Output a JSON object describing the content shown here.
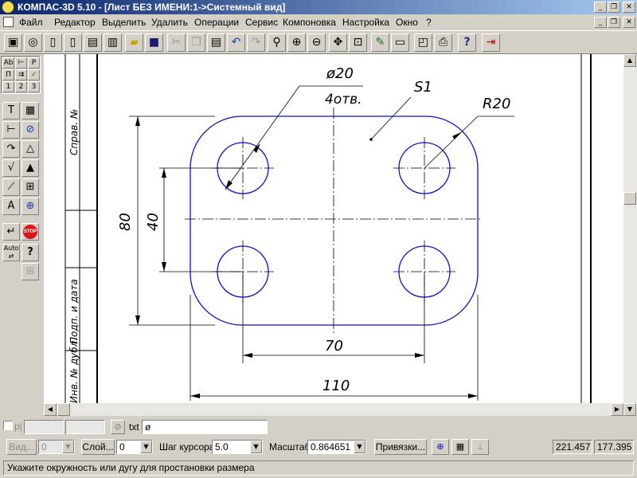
{
  "window": {
    "title": "КОМПАС-3D 5.10 - [Лист БЕЗ ИМЕНИ:1->Системный вид]",
    "minimize_glyph": "_",
    "restore_glyph": "❐",
    "close_glyph": "✕"
  },
  "menu": [
    {
      "label": "Файл"
    },
    {
      "label": "Редактор"
    },
    {
      "label": "Выделить"
    },
    {
      "label": "Удалить"
    },
    {
      "label": "Операции"
    },
    {
      "label": "Сервис"
    },
    {
      "label": "Компоновка"
    },
    {
      "label": "Настройка"
    },
    {
      "label": "Окно"
    },
    {
      "label": "?"
    }
  ],
  "toolbar_icons": [
    "new-sheet-icon",
    "new-fragment-icon",
    "new-document-icon",
    "new-text-icon",
    "new-spec-icon",
    "open-icon",
    "save-icon",
    "cut-icon",
    "copy-icon",
    "paste-icon",
    "undo-icon",
    "redo-icon",
    "zoom-window-icon",
    "zoom-in-icon",
    "zoom-out-icon",
    "pan-icon",
    "zoom-all-icon",
    "refresh-icon",
    "layers-icon",
    "print-preview-icon",
    "print-icon",
    "help-icon",
    "exit-icon"
  ],
  "palette": {
    "mini_labels": [
      "Ab",
      "P",
      "П",
      "1",
      "2",
      "3"
    ]
  },
  "drawing": {
    "dim_d20": "ø20",
    "dim_4holes": "4отв.",
    "dim_s1": "S1",
    "dim_r20": "R20",
    "dim_80": "80",
    "dim_40": "40",
    "dim_70": "70",
    "dim_110": "110",
    "stamp_sprav": "Справ. №",
    "stamp_podp": "Подп. и дата",
    "stamp_inv": "Инв. № дубл."
  },
  "input_bar": {
    "point_label": "p|",
    "txt_label": "txt",
    "txt_value": "ø"
  },
  "params_bar": {
    "view_label": "Вид...",
    "view_value": "0",
    "layer_label": "Слой...",
    "layer_value": "0",
    "step_label": "Шаг курсора",
    "step_value": "5.0",
    "scale_label": "Масштаб",
    "scale_value": "0.864651",
    "snaps_label": "Привязки...",
    "coord_x": "221.457",
    "coord_y": "177.395"
  },
  "status": {
    "hint": "Укажите окружность или дугу для простановки размера"
  },
  "colors": {
    "title_bar": "#0a246a",
    "drawing_lines": "#1010c8",
    "dimension_lines": "#000000",
    "face": "#d4d0c8",
    "stop_red": "#d81818"
  }
}
